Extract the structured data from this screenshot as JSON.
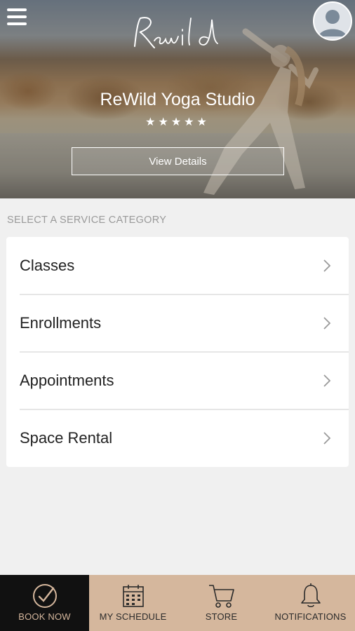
{
  "header": {
    "logo_text": "Rewild",
    "studio_name": "ReWild Yoga Studio",
    "rating_stars": "★★★★★",
    "rating": 5,
    "view_details_label": "View Details"
  },
  "services": {
    "section_label": "SELECT A SERVICE CATEGORY",
    "items": [
      {
        "label": "Classes"
      },
      {
        "label": "Enrollments"
      },
      {
        "label": "Appointments"
      },
      {
        "label": "Space Rental"
      }
    ]
  },
  "bottom_nav": {
    "tabs": [
      {
        "label": "BOOK NOW",
        "icon": "check-circle-icon",
        "active": true
      },
      {
        "label": "MY SCHEDULE",
        "icon": "calendar-icon",
        "active": false
      },
      {
        "label": "STORE",
        "icon": "cart-icon",
        "active": false
      },
      {
        "label": "NOTIFICATIONS",
        "icon": "bell-icon",
        "active": false
      }
    ]
  },
  "colors": {
    "accent": "#d5b79d",
    "active_tab": "#111111",
    "background": "#f0f0f0"
  }
}
